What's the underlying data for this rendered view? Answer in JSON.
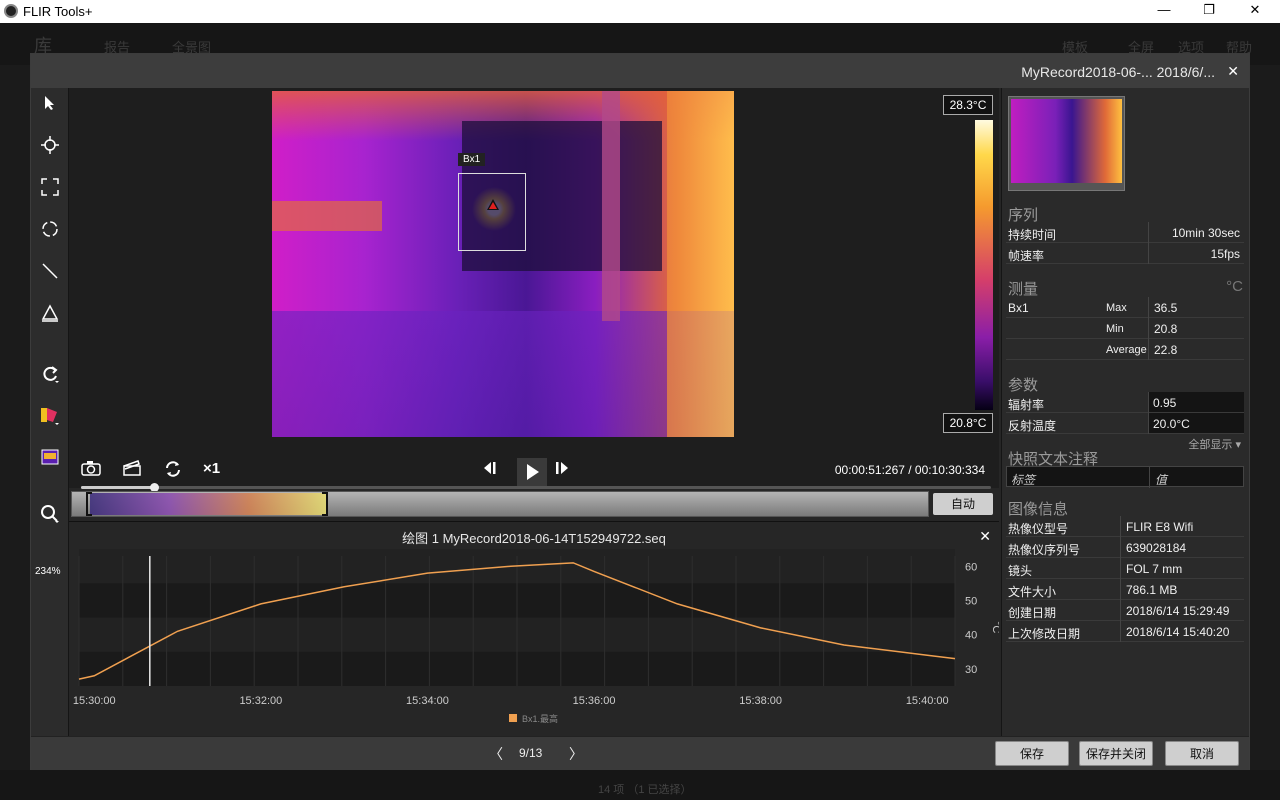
{
  "window": {
    "title": "FLIR Tools+",
    "minimize": "—",
    "maximize": "❐",
    "close": "✕"
  },
  "bg_menu": {
    "items": [
      "库",
      "报告",
      "全景图",
      "模板",
      "全屏",
      "选项",
      "帮助"
    ]
  },
  "bg_status": "14 项 （1 已选择）",
  "dialog": {
    "title": "MyRecord2018-06-...   2018/6/...",
    "close": "✕"
  },
  "toolbar": {
    "zoom": "234%"
  },
  "image": {
    "scale_max": "28.3°C",
    "scale_min": "20.8°C",
    "box_label": "Bx1"
  },
  "playback": {
    "speed": "×1",
    "time": "00:00:51:267 / 00:10:30:334",
    "progress": 0.08,
    "auto_label": "自动"
  },
  "plot": {
    "title": "绘图 1 MyRecord2018-06-14T152949722.seq",
    "close": "✕",
    "legend": "Bx1.最高",
    "y_unit": "°C",
    "x_ticks": [
      "15:30:00",
      "15:32:00",
      "15:34:00",
      "15:36:00",
      "15:38:00",
      "15:40:00"
    ],
    "y_ticks": [
      "60",
      "50",
      "40",
      "30"
    ]
  },
  "sidebar": {
    "sequence": {
      "title": "序列",
      "rows": [
        {
          "key": "持续时间",
          "value": "10min 30sec"
        },
        {
          "key": "帧速率",
          "value": "15fps"
        }
      ]
    },
    "measurement": {
      "title": "测量",
      "unit": "°C",
      "name": "Bx1",
      "rows": [
        {
          "key": "Max",
          "value": "36.5"
        },
        {
          "key": "Min",
          "value": "20.8"
        },
        {
          "key": "Average",
          "value": "22.8"
        }
      ]
    },
    "params": {
      "title": "参数",
      "rows": [
        {
          "key": "辐射率",
          "value": "0.95"
        },
        {
          "key": "反射温度",
          "value": "20.0°C"
        }
      ],
      "show_all": "全部显示 ▾"
    },
    "snapshot": {
      "title": "快照文本注释",
      "label_placeholder": "标签",
      "value_placeholder": "值"
    },
    "info": {
      "title": "图像信息",
      "rows": [
        {
          "key": "热像仪型号",
          "value": "FLIR E8 Wifi"
        },
        {
          "key": "热像仪序列号",
          "value": "639028184"
        },
        {
          "key": "镜头",
          "value": "FOL 7 mm"
        },
        {
          "key": "文件大小",
          "value": "786.1 MB"
        },
        {
          "key": "创建日期",
          "value": "2018/6/14 15:29:49"
        },
        {
          "key": "上次修改日期",
          "value": "2018/6/14 15:40:20"
        }
      ]
    }
  },
  "footer": {
    "pager": "9/13",
    "prev": "〈",
    "next": "〉",
    "save": "保存",
    "save_close": "保存并关闭",
    "cancel": "取消"
  },
  "chart_data": {
    "type": "line",
    "xlabel": "",
    "ylabel": "°C",
    "ylim": [
      25,
      63
    ],
    "xlim": [
      "15:29:49",
      "15:40:20"
    ],
    "series": [
      {
        "name": "Bx1.最高",
        "color": "#f0a050",
        "x": [
          "15:29:49",
          "15:30:00",
          "15:31:00",
          "15:32:00",
          "15:33:00",
          "15:34:00",
          "15:35:00",
          "15:35:45",
          "15:36:00",
          "15:37:00",
          "15:38:00",
          "15:39:00",
          "15:40:00",
          "15:40:20"
        ],
        "values": [
          27.0,
          28.0,
          41.0,
          49.0,
          54.0,
          58.0,
          60.0,
          61.0,
          58.5,
          49.0,
          42.0,
          37.0,
          34.0,
          33.0
        ]
      }
    ],
    "cursor_time": "15:30:40",
    "grid": true
  }
}
